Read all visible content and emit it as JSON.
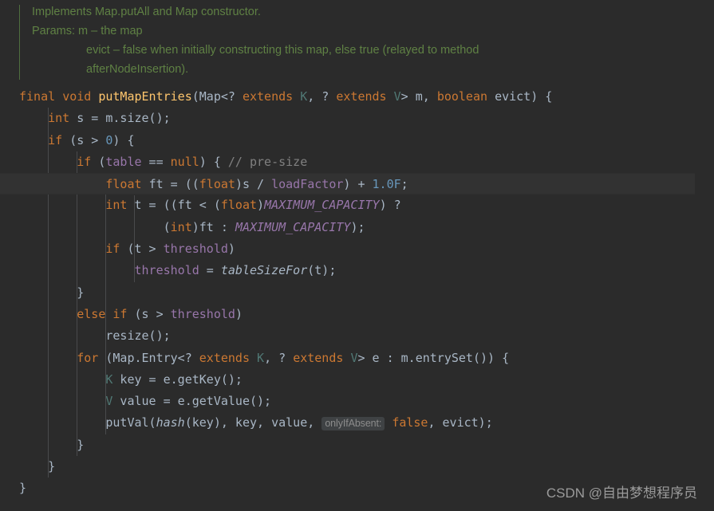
{
  "editor": {
    "theme": "darcula",
    "background_color": "#2b2b2b",
    "caret_line_color": "#323232",
    "default_text_color": "#a9b7c6",
    "keyword_color": "#cc7832",
    "method_color": "#ffc66d",
    "field_color": "#9876aa",
    "number_color": "#6897bb",
    "comment_color": "#808080",
    "type_param_color": "#507874",
    "doc_color": "#5f8144",
    "hint_background_color": "#3f4244",
    "hint_text_color": "#8c8c8c"
  },
  "doc_block": {
    "gutter_color": "#4f6e3f",
    "lines": [
      {
        "indent": false,
        "text": "Implements Map.putAll and Map constructor."
      },
      {
        "indent": false,
        "text": "Params: m – the map"
      },
      {
        "indent": true,
        "text": "evict – false when initially constructing this map, else true (relayed to method"
      },
      {
        "indent": true,
        "text": "afterNodeInsertion)."
      }
    ]
  },
  "code": {
    "language": "java",
    "caret_line_index": 3,
    "lines": [
      {
        "index": 0,
        "tokens": [
          {
            "t": "final ",
            "c": "kw"
          },
          {
            "t": "void ",
            "c": "kw"
          },
          {
            "t": "putMapEntries",
            "c": "mth"
          },
          {
            "t": "(Map<? ",
            "c": "plain"
          },
          {
            "t": "extends ",
            "c": "kw"
          },
          {
            "t": "K",
            "c": "typ"
          },
          {
            "t": ", ? ",
            "c": "plain"
          },
          {
            "t": "extends ",
            "c": "kw"
          },
          {
            "t": "V",
            "c": "typ"
          },
          {
            "t": "> m, ",
            "c": "plain"
          },
          {
            "t": "boolean ",
            "c": "kw"
          },
          {
            "t": "evict) {",
            "c": "plain"
          }
        ]
      },
      {
        "index": 1,
        "tokens": [
          {
            "t": "    ",
            "c": "plain"
          },
          {
            "t": "int ",
            "c": "kw"
          },
          {
            "t": "s = m.size();",
            "c": "plain"
          }
        ]
      },
      {
        "index": 2,
        "tokens": [
          {
            "t": "    ",
            "c": "plain"
          },
          {
            "t": "if ",
            "c": "kw"
          },
          {
            "t": "(s > ",
            "c": "plain"
          },
          {
            "t": "0",
            "c": "num"
          },
          {
            "t": ") {",
            "c": "plain"
          }
        ]
      },
      {
        "index": 3,
        "tokens": [
          {
            "t": "        ",
            "c": "plain"
          },
          {
            "t": "if ",
            "c": "kw"
          },
          {
            "t": "(",
            "c": "plain"
          },
          {
            "t": "table",
            "c": "fld"
          },
          {
            "t": " == ",
            "c": "plain"
          },
          {
            "t": "null",
            "c": "kw"
          },
          {
            "t": ") { ",
            "c": "plain"
          },
          {
            "t": "// pre-size",
            "c": "cmt"
          }
        ]
      },
      {
        "index": 4,
        "caret": true,
        "tokens": [
          {
            "t": "            ",
            "c": "plain"
          },
          {
            "t": "float ",
            "c": "kw"
          },
          {
            "t": "ft = ((",
            "c": "plain"
          },
          {
            "t": "float",
            "c": "kw"
          },
          {
            "t": ")s / ",
            "c": "plain"
          },
          {
            "t": "loadFactor",
            "c": "fld"
          },
          {
            "t": ") + ",
            "c": "plain"
          },
          {
            "t": "1.0F",
            "c": "num"
          },
          {
            "t": ";",
            "c": "plain"
          }
        ]
      },
      {
        "index": 5,
        "tokens": [
          {
            "t": "            ",
            "c": "plain"
          },
          {
            "t": "int ",
            "c": "kw"
          },
          {
            "t": "t = ((ft < (",
            "c": "plain"
          },
          {
            "t": "float",
            "c": "kw"
          },
          {
            "t": ")",
            "c": "plain"
          },
          {
            "t": "MAXIMUM_CAPACITY",
            "c": "sfld"
          },
          {
            "t": ") ?",
            "c": "plain"
          }
        ]
      },
      {
        "index": 6,
        "tokens": [
          {
            "t": "                    (",
            "c": "plain"
          },
          {
            "t": "int",
            "c": "kw"
          },
          {
            "t": ")ft : ",
            "c": "plain"
          },
          {
            "t": "MAXIMUM_CAPACITY",
            "c": "sfld"
          },
          {
            "t": ");",
            "c": "plain"
          }
        ]
      },
      {
        "index": 7,
        "tokens": [
          {
            "t": "            ",
            "c": "plain"
          },
          {
            "t": "if ",
            "c": "kw"
          },
          {
            "t": "(t > ",
            "c": "plain"
          },
          {
            "t": "threshold",
            "c": "fld"
          },
          {
            "t": ")",
            "c": "plain"
          }
        ]
      },
      {
        "index": 8,
        "tokens": [
          {
            "t": "                ",
            "c": "plain"
          },
          {
            "t": "threshold",
            "c": "fld"
          },
          {
            "t": " = ",
            "c": "plain"
          },
          {
            "t": "tableSizeFor",
            "c": "smth"
          },
          {
            "t": "(t);",
            "c": "plain"
          }
        ]
      },
      {
        "index": 9,
        "tokens": [
          {
            "t": "        }",
            "c": "plain"
          }
        ]
      },
      {
        "index": 10,
        "tokens": [
          {
            "t": "        ",
            "c": "plain"
          },
          {
            "t": "else ",
            "c": "kw"
          },
          {
            "t": "if ",
            "c": "kw"
          },
          {
            "t": "(s > ",
            "c": "plain"
          },
          {
            "t": "threshold",
            "c": "fld"
          },
          {
            "t": ")",
            "c": "plain"
          }
        ]
      },
      {
        "index": 11,
        "tokens": [
          {
            "t": "            resize();",
            "c": "plain"
          }
        ]
      },
      {
        "index": 12,
        "tokens": [
          {
            "t": "        ",
            "c": "plain"
          },
          {
            "t": "for ",
            "c": "kw"
          },
          {
            "t": "(Map.Entry<? ",
            "c": "plain"
          },
          {
            "t": "extends ",
            "c": "kw"
          },
          {
            "t": "K",
            "c": "typ"
          },
          {
            "t": ", ? ",
            "c": "plain"
          },
          {
            "t": "extends ",
            "c": "kw"
          },
          {
            "t": "V",
            "c": "typ"
          },
          {
            "t": "> e : m.entrySet()) {",
            "c": "plain"
          }
        ]
      },
      {
        "index": 13,
        "tokens": [
          {
            "t": "            ",
            "c": "plain"
          },
          {
            "t": "K",
            "c": "typ"
          },
          {
            "t": " key = e.getKey();",
            "c": "plain"
          }
        ]
      },
      {
        "index": 14,
        "tokens": [
          {
            "t": "            ",
            "c": "plain"
          },
          {
            "t": "V",
            "c": "typ"
          },
          {
            "t": " value = e.getValue();",
            "c": "plain"
          }
        ]
      },
      {
        "index": 15,
        "tokens": [
          {
            "t": "            putVal(",
            "c": "plain"
          },
          {
            "t": "hash",
            "c": "smth"
          },
          {
            "t": "(key), key, value, ",
            "c": "plain"
          },
          {
            "t": "onlyIfAbsent:",
            "c": "hint"
          },
          {
            "t": " ",
            "c": "plain"
          },
          {
            "t": "false",
            "c": "kw"
          },
          {
            "t": ", evict);",
            "c": "plain"
          }
        ]
      },
      {
        "index": 16,
        "tokens": [
          {
            "t": "        }",
            "c": "plain"
          }
        ]
      },
      {
        "index": 17,
        "tokens": [
          {
            "t": "    }",
            "c": "plain"
          }
        ]
      },
      {
        "index": 18,
        "tokens": [
          {
            "t": "}",
            "c": "plain"
          }
        ]
      }
    ]
  },
  "watermark": {
    "text": "CSDN @自由梦想程序员"
  }
}
